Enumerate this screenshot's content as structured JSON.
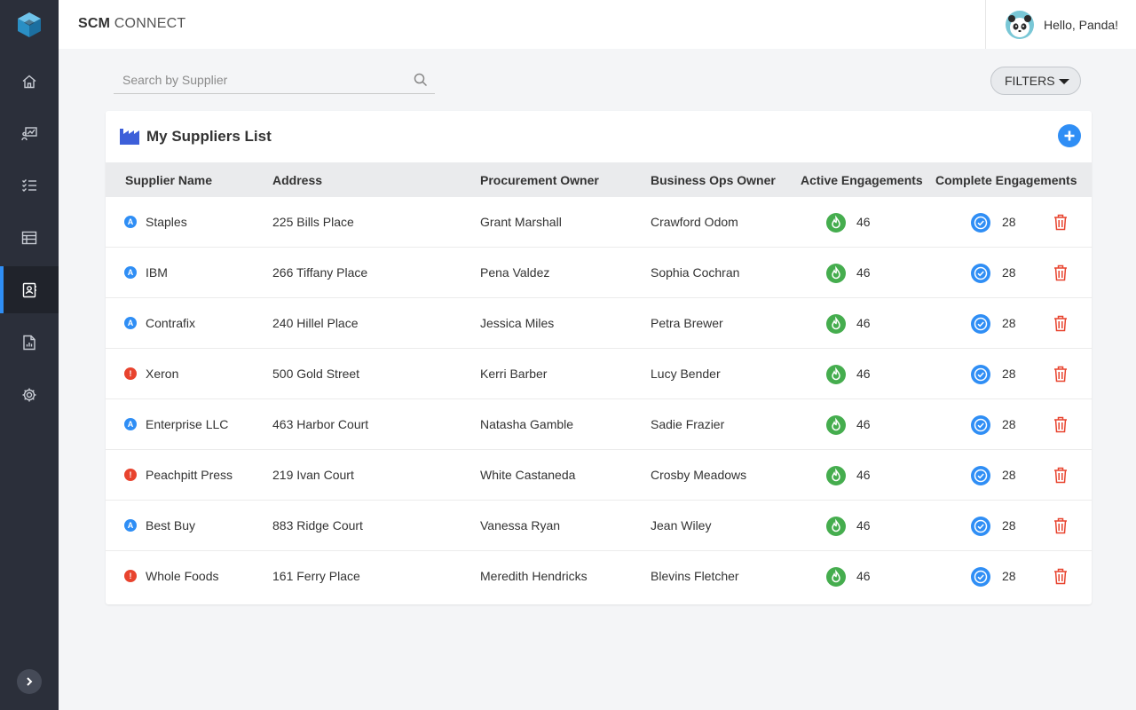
{
  "app": {
    "brand_bold": "SCM",
    "brand_rest": " CONNECT",
    "greeting": "Hello, Panda!"
  },
  "sidebar": {
    "items": [
      {
        "name": "home-icon",
        "active": false
      },
      {
        "name": "presentation-icon",
        "active": false
      },
      {
        "name": "checklist-icon",
        "active": false
      },
      {
        "name": "table-icon",
        "active": false
      },
      {
        "name": "contacts-icon",
        "active": true
      },
      {
        "name": "report-icon",
        "active": false
      },
      {
        "name": "settings-icon",
        "active": false
      }
    ]
  },
  "search": {
    "placeholder": "Search by Supplier",
    "value": ""
  },
  "filters": {
    "label": "FILTERS"
  },
  "list": {
    "title": "My Suppliers List",
    "columns": {
      "supplier_name": "Supplier Name",
      "address": "Address",
      "procurement_owner": "Procurement Owner",
      "business_ops_owner": "Business Ops Owner",
      "active_engagements": "Active Engagements",
      "complete_engagements": "Complete Engagements"
    },
    "rows": [
      {
        "status": "A",
        "status_color": "blue",
        "name": "Staples",
        "address": "225 Bills Place",
        "procurement": "Grant Marshall",
        "business_ops": "Crawford Odom",
        "active": "46",
        "complete": "28"
      },
      {
        "status": "A",
        "status_color": "blue",
        "name": "IBM",
        "address": "266 Tiffany Place",
        "procurement": "Pena Valdez",
        "business_ops": "Sophia Cochran",
        "active": "46",
        "complete": "28"
      },
      {
        "status": "A",
        "status_color": "blue",
        "name": "Contrafix",
        "address": "240 Hillel Place",
        "procurement": "Jessica Miles",
        "business_ops": "Petra Brewer",
        "active": "46",
        "complete": "28"
      },
      {
        "status": "!",
        "status_color": "red",
        "name": "Xeron",
        "address": "500 Gold Street",
        "procurement": "Kerri Barber",
        "business_ops": "Lucy Bender",
        "active": "46",
        "complete": "28"
      },
      {
        "status": "A",
        "status_color": "blue",
        "name": "Enterprise LLC",
        "address": "463 Harbor Court",
        "procurement": "Natasha Gamble",
        "business_ops": "Sadie Frazier",
        "active": "46",
        "complete": "28"
      },
      {
        "status": "!",
        "status_color": "red",
        "name": "Peachpitt Press",
        "address": "219 Ivan Court",
        "procurement": "White Castaneda",
        "business_ops": "Crosby Meadows",
        "active": "46",
        "complete": "28"
      },
      {
        "status": "A",
        "status_color": "blue",
        "name": "Best Buy",
        "address": "883 Ridge Court",
        "procurement": "Vanessa Ryan",
        "business_ops": "Jean Wiley",
        "active": "46",
        "complete": "28"
      },
      {
        "status": "!",
        "status_color": "red",
        "name": "Whole Foods",
        "address": "161 Ferry Place",
        "procurement": "Meredith Hendricks",
        "business_ops": "Blevins Fletcher",
        "active": "46",
        "complete": "28"
      }
    ]
  },
  "colors": {
    "accent": "#2f8ef5",
    "sidebar": "#2b2f3a",
    "success": "#45ad4e",
    "danger": "#e8432e"
  }
}
